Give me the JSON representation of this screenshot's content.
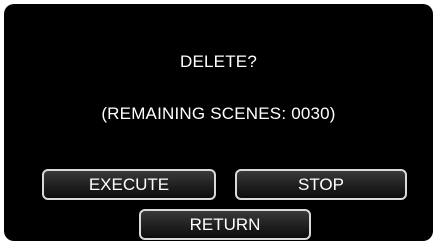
{
  "dialog": {
    "title": "DELETE?",
    "remaining": "(REMAINING SCENES: 0030)"
  },
  "buttons": {
    "execute": "EXECUTE",
    "stop": "STOP",
    "return": "RETURN"
  },
  "colors": {
    "background": "#000000",
    "text": "#ffffff",
    "button_border": "#d9d9d9"
  }
}
